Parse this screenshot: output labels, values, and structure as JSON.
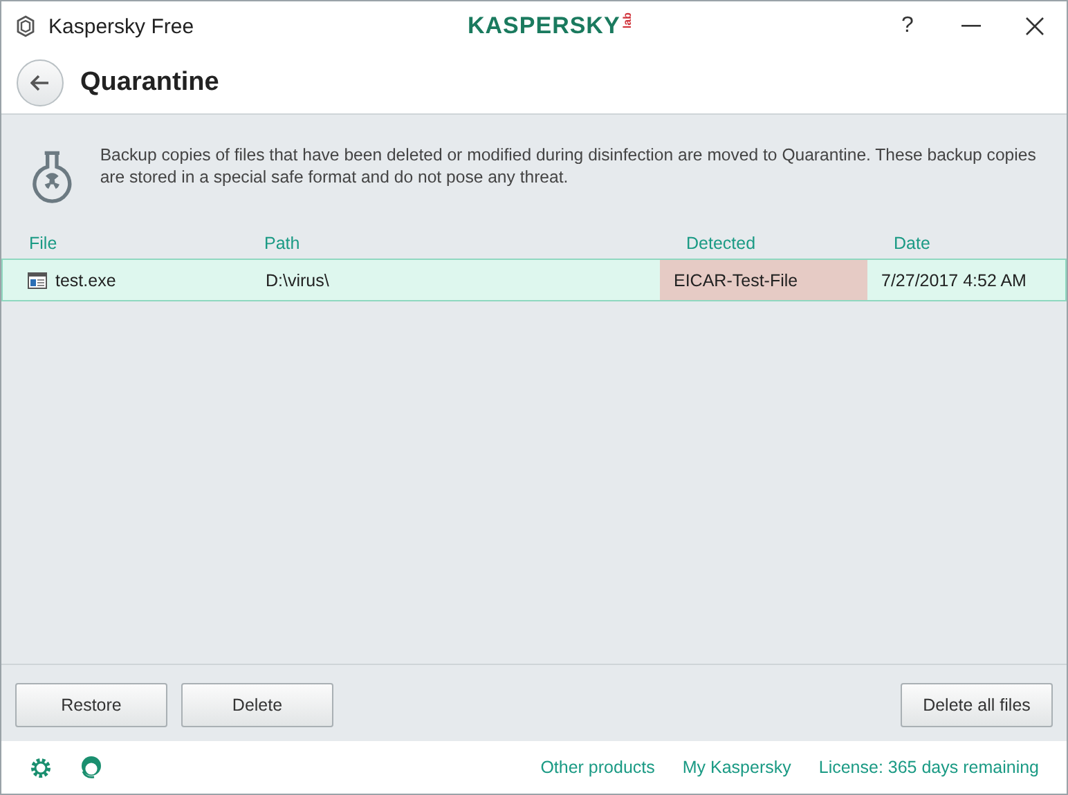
{
  "window": {
    "title": "Kaspersky Free",
    "logo": "KASPERSKY",
    "logo_suffix": "lab",
    "help": "?"
  },
  "page": {
    "title": "Quarantine",
    "description": "Backup copies of files that have been deleted or modified during disinfection are moved to Quarantine. These backup copies are stored in a special safe format and do not pose any threat."
  },
  "table": {
    "columns": [
      "File",
      "Path",
      "Detected",
      "Date"
    ],
    "rows": [
      {
        "file": "test.exe",
        "path": "D:\\virus\\",
        "detected": "EICAR-Test-File",
        "date": "7/27/2017 4:52 AM",
        "selected": true
      }
    ]
  },
  "buttons": [
    {
      "label": "Restore"
    },
    {
      "label": "Delete"
    },
    {
      "label": "Delete all files"
    }
  ],
  "footer": {
    "links": [
      "Other products",
      "My Kaspersky",
      "License: 365 days remaining"
    ]
  }
}
